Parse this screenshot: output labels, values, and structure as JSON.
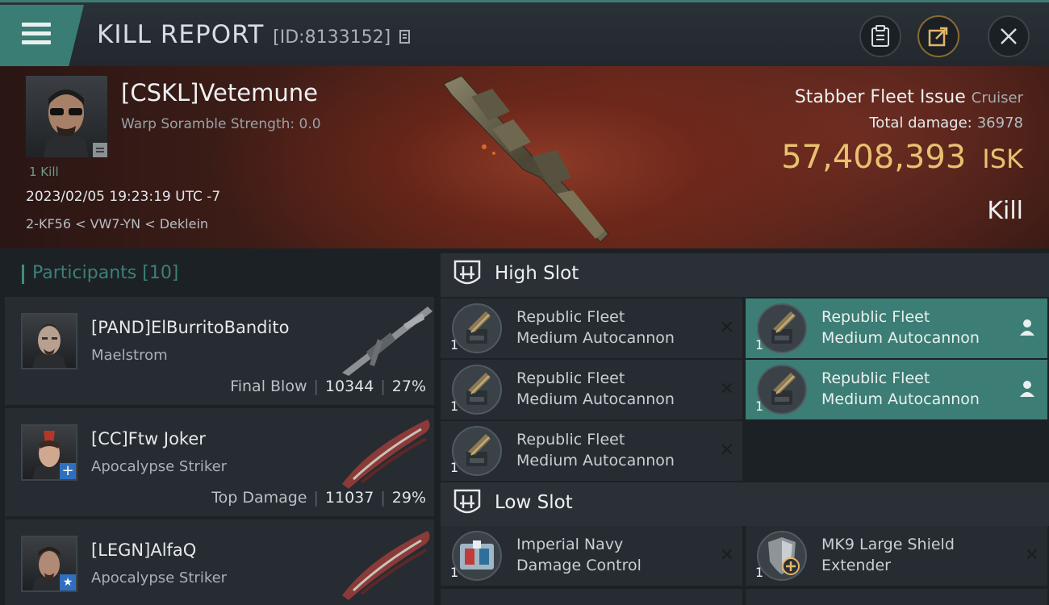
{
  "header": {
    "title": "KILL REPORT",
    "report_id": "[ID:8133152]"
  },
  "victim": {
    "name": "[CSKL]Vetemune",
    "scramble": "Warp Soramble Strength: 0.0",
    "kills": "1 Kill",
    "time": "2023/02/05 19:23:19 UTC -7",
    "location": "2-KF56 < VW7-YN < Deklein",
    "ship": "Stabber Fleet Issue",
    "ship_class": "Cruiser",
    "total_damage_label": "Total damage:",
    "total_damage": "36978",
    "isk_value": "57,408,393",
    "isk_unit": "ISK",
    "result": "Kill"
  },
  "participants": {
    "label": "Participants",
    "count": "[10]",
    "rows": [
      {
        "name": "[PAND]ElBurritoBandito",
        "ship": "Maelstrom",
        "tag": "Final Blow",
        "damage": "10344",
        "pct": "27%"
      },
      {
        "name": "[CC]Ftw Joker",
        "ship": "Apocalypse Striker",
        "tag": "Top Damage",
        "damage": "11037",
        "pct": "29%"
      },
      {
        "name": "[LEGN]AlfaQ",
        "ship": "Apocalypse Striker",
        "tag": "",
        "damage": "",
        "pct": ""
      }
    ]
  },
  "high_slot": {
    "label": "High Slot",
    "modules": [
      {
        "line1": "Republic Fleet",
        "line2": "Medium Autocannon",
        "qty": "1",
        "state": "destroyed"
      },
      {
        "line1": "Republic Fleet",
        "line2": "Medium Autocannon",
        "qty": "1",
        "state": "dropped"
      },
      {
        "line1": "Republic Fleet",
        "line2": "Medium Autocannon",
        "qty": "1",
        "state": "destroyed"
      },
      {
        "line1": "Republic Fleet",
        "line2": "Medium Autocannon",
        "qty": "1",
        "state": "dropped"
      },
      {
        "line1": "Republic Fleet",
        "line2": "Medium Autocannon",
        "qty": "1",
        "state": "destroyed"
      }
    ]
  },
  "low_slot": {
    "label": "Low Slot",
    "modules": [
      {
        "line1": "Imperial Navy",
        "line2": "Damage Control",
        "qty": "1",
        "state": "destroyed"
      },
      {
        "line1": "MK9 Large Shield",
        "line2": "Extender",
        "qty": "1",
        "state": "destroyed"
      }
    ]
  },
  "colors": {
    "accent": "#3c7d75",
    "isk": "#e8c170"
  }
}
